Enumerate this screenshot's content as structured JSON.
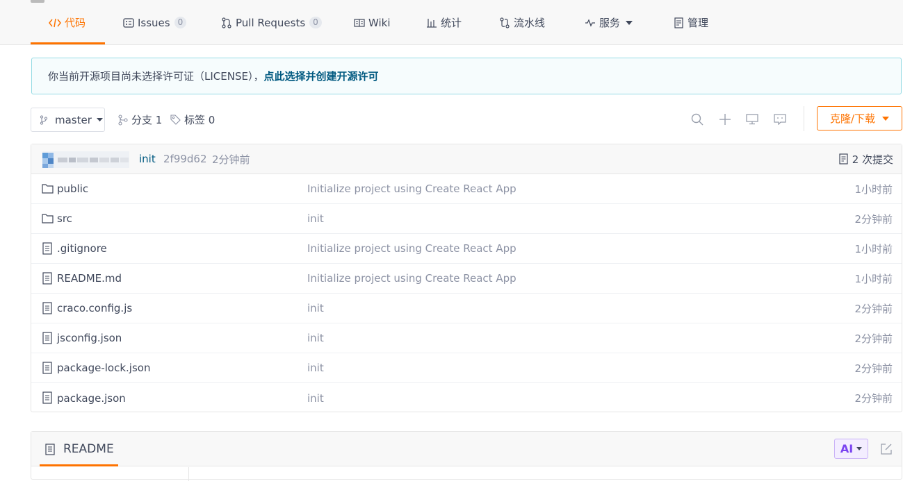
{
  "tabs": [
    {
      "label": "代码",
      "icon": "code-icon",
      "active": true
    },
    {
      "label": "Issues",
      "icon": "issues-icon",
      "badge": "0"
    },
    {
      "label": "Pull Requests",
      "icon": "pull-request-icon",
      "badge": "0"
    },
    {
      "label": "Wiki",
      "icon": "wiki-icon"
    },
    {
      "label": "统计",
      "icon": "stats-icon"
    },
    {
      "label": "流水线",
      "icon": "pipeline-icon"
    },
    {
      "label": "服务",
      "icon": "service-icon",
      "dropdown": true
    },
    {
      "label": "管理",
      "icon": "manage-icon"
    }
  ],
  "notice": {
    "text": "你当前开源项目尚未选择许可证（LICENSE），",
    "link": "点此选择并创建开源许可"
  },
  "branch": {
    "current": "master",
    "branches_label": "分支 1",
    "tags_label": "标签 0"
  },
  "toolbar": {
    "clone_label": "克隆/下载"
  },
  "commit": {
    "message": "init",
    "hash": "2f99d62",
    "time": "2分钟前",
    "count_label": "2 次提交"
  },
  "files": [
    {
      "name": "public",
      "type": "folder",
      "message": "Initialize project using Create React App",
      "time": "1小时前"
    },
    {
      "name": "src",
      "type": "folder",
      "message": "init",
      "time": "2分钟前"
    },
    {
      "name": ".gitignore",
      "type": "file",
      "message": "Initialize project using Create React App",
      "time": "1小时前"
    },
    {
      "name": "README.md",
      "type": "file",
      "message": "Initialize project using Create React App",
      "time": "1小时前"
    },
    {
      "name": "craco.config.js",
      "type": "file",
      "message": "init",
      "time": "2分钟前"
    },
    {
      "name": "jsconfig.json",
      "type": "file",
      "message": "init",
      "time": "2分钟前"
    },
    {
      "name": "package-lock.json",
      "type": "file",
      "message": "init",
      "time": "2分钟前"
    },
    {
      "name": "package.json",
      "type": "file",
      "message": "init",
      "time": "2分钟前"
    }
  ],
  "readme": {
    "title": "README",
    "ai_label": "AI"
  },
  "colors": {
    "accent": "#fe7300",
    "link": "#005980",
    "muted": "#8c92a4"
  }
}
